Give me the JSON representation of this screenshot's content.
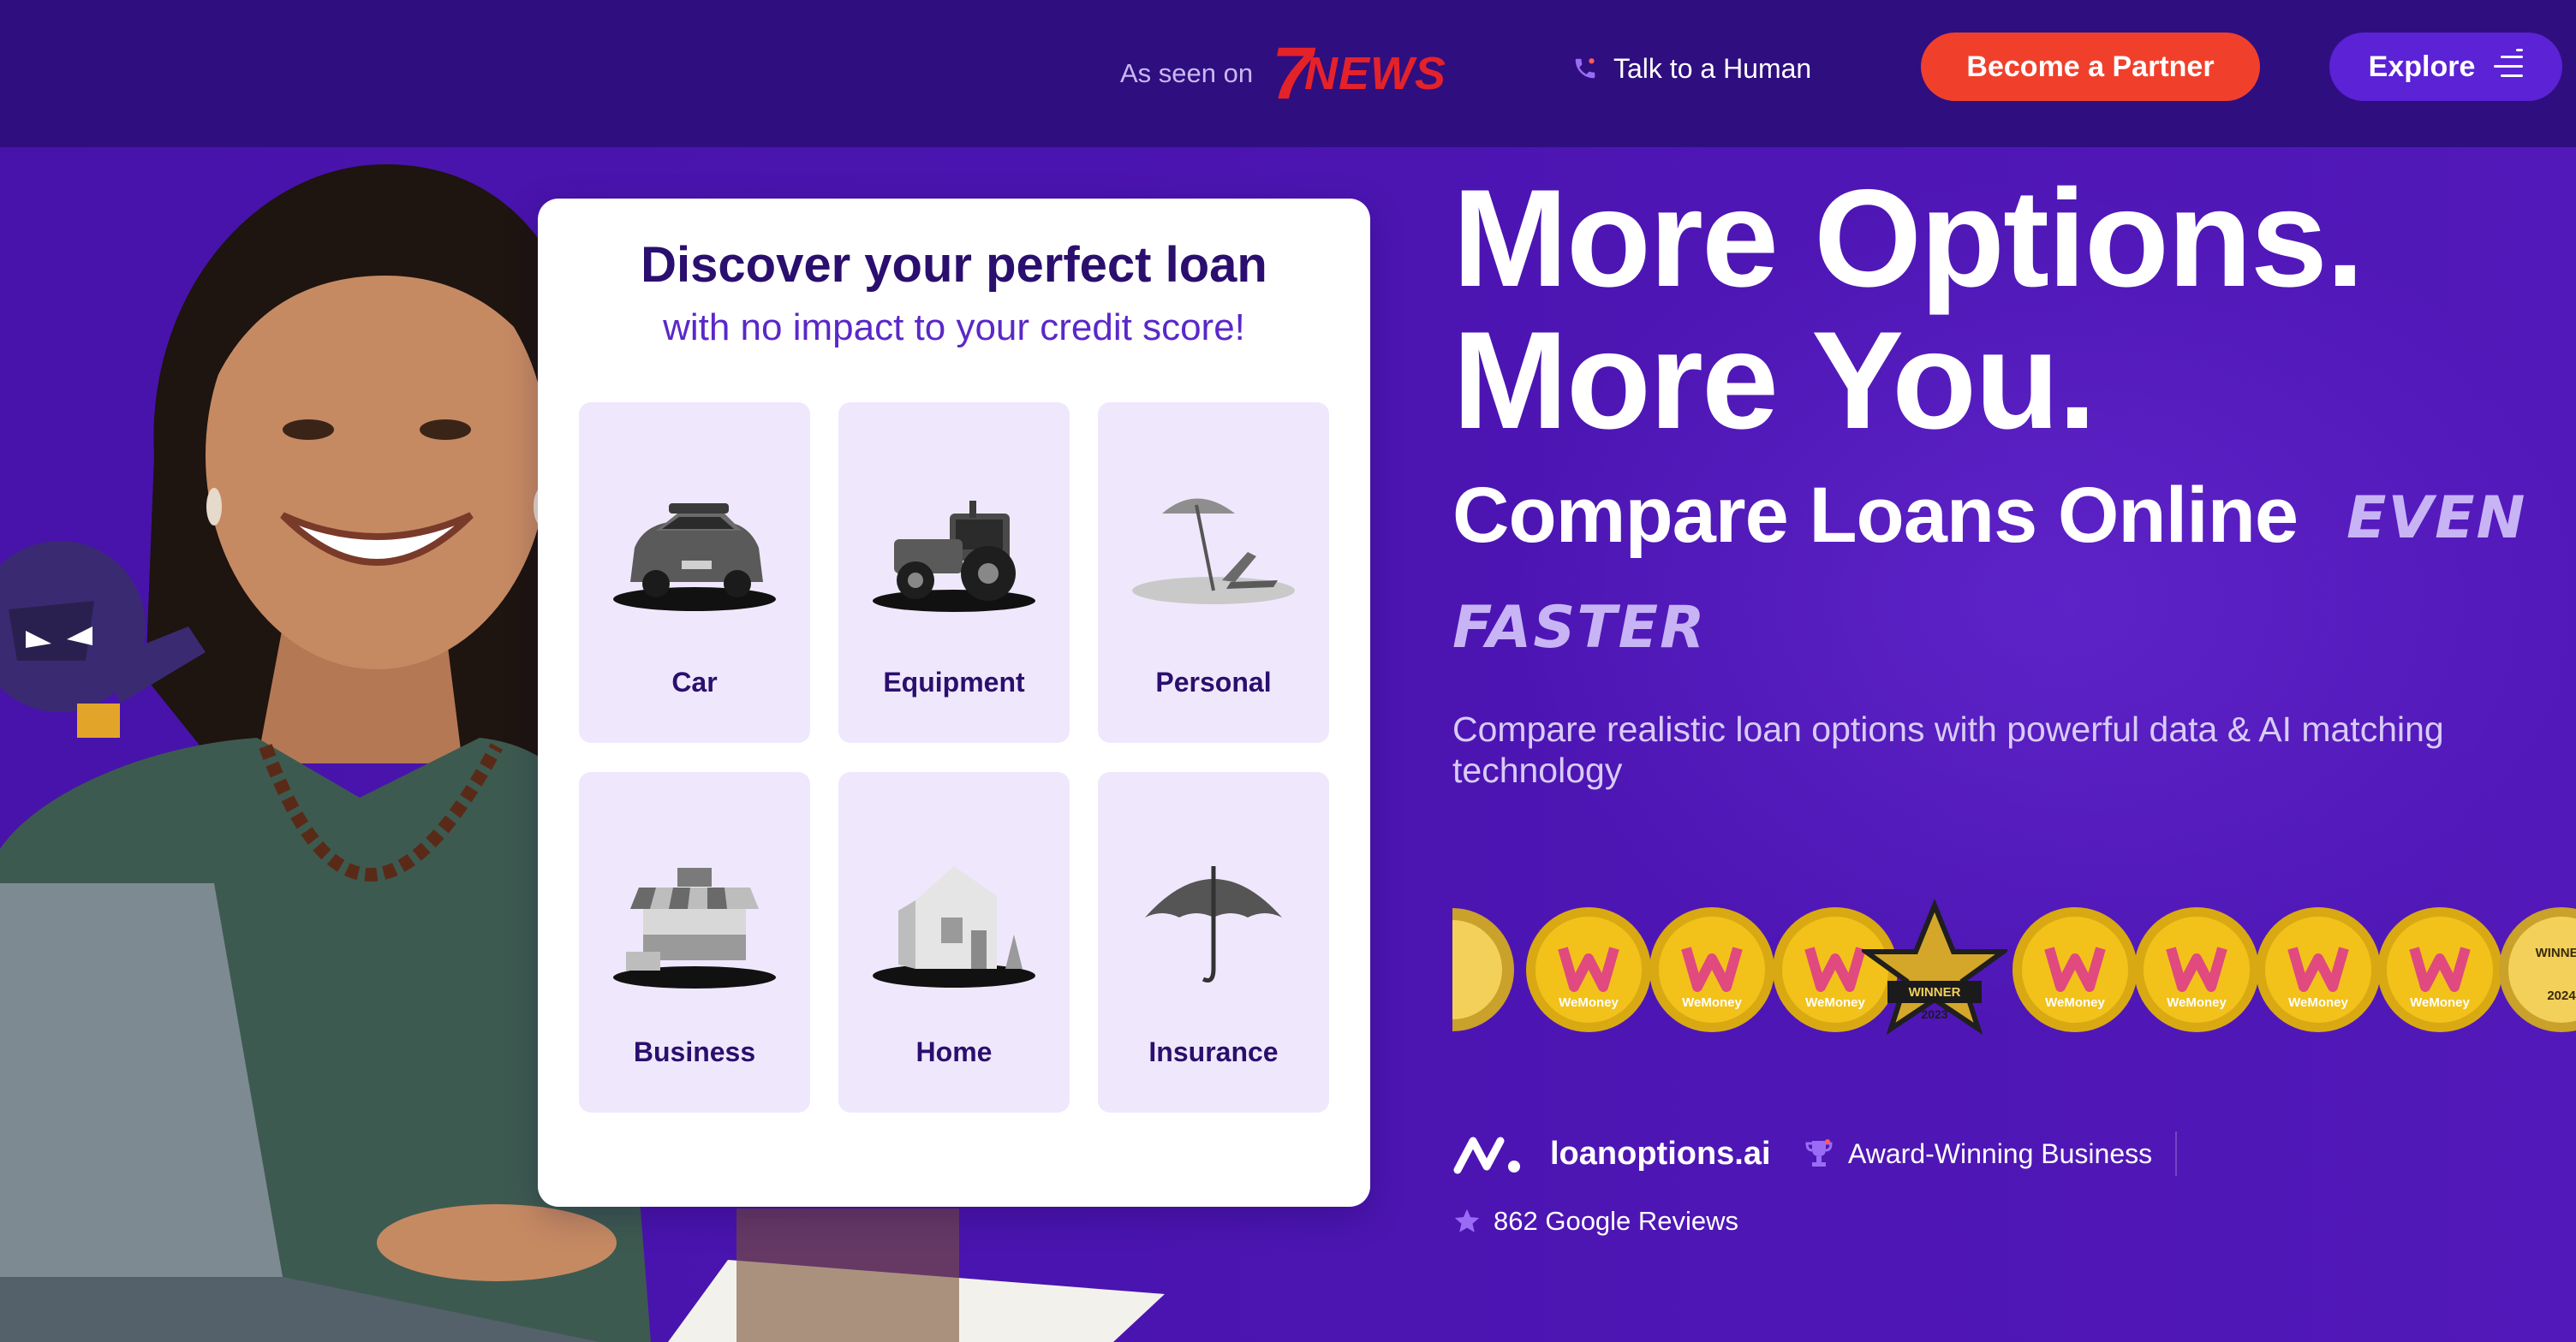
{
  "colors": {
    "background": "#4b16b0",
    "navbar": "#2f0e80",
    "partner_button": "#f0402c",
    "explore_button": "#5b22d6",
    "card_tile": "#efe8fc",
    "card_title": "#2a0f6e",
    "card_subtitle": "#5a28c8",
    "accent_text": "#c8b4f5",
    "news_red": "#e4222a",
    "award_gold": "#f2c21b"
  },
  "header": {
    "seen_on_label": "As seen on",
    "news_logo_number": "7",
    "news_logo_text": "NEWS",
    "talk_label": "Talk to a Human",
    "talk_icon": "phone-icon",
    "partner_button": "Become a Partner",
    "explore_button": "Explore",
    "explore_icon": "menu-icon"
  },
  "loan_card": {
    "title": "Discover your perfect loan",
    "subtitle": "with no impact to your credit score!",
    "options": [
      {
        "label": "Car",
        "icon": "car-icon"
      },
      {
        "label": "Equipment",
        "icon": "tractor-icon"
      },
      {
        "label": "Personal",
        "icon": "beach-chair-icon"
      },
      {
        "label": "Business",
        "icon": "market-stall-icon"
      },
      {
        "label": "Home",
        "icon": "house-icon"
      },
      {
        "label": "Insurance",
        "icon": "umbrella-icon"
      }
    ]
  },
  "hero": {
    "headline_line1": "More Options.",
    "headline_line2": "More You.",
    "subheadline": "Compare Loans Online",
    "accent_word1": "EVEN",
    "accent_word2": "FASTER",
    "description": "Compare realistic loan options with powerful data & AI matching technology"
  },
  "awards": {
    "badges": [
      {
        "kind": "partial-gold-seal"
      },
      {
        "kind": "wemoney",
        "text": "WeMoney"
      },
      {
        "kind": "wemoney",
        "text": "WeMoney"
      },
      {
        "kind": "wemoney",
        "text": "WeMoney"
      },
      {
        "kind": "star-winner",
        "text": "WINNER",
        "year": "2023"
      },
      {
        "kind": "wemoney",
        "text": "WeMoney"
      },
      {
        "kind": "wemoney",
        "text": "WeMoney"
      },
      {
        "kind": "wemoney",
        "text": "WeMoney"
      },
      {
        "kind": "wemoney",
        "text": "WeMoney"
      },
      {
        "kind": "australian-broking",
        "text": "WINNER",
        "year": "2024"
      }
    ]
  },
  "footer": {
    "brand_name": "loanoptions.ai",
    "award_label": "Award-Winning Business",
    "reviews_label": "862 Google Reviews"
  }
}
